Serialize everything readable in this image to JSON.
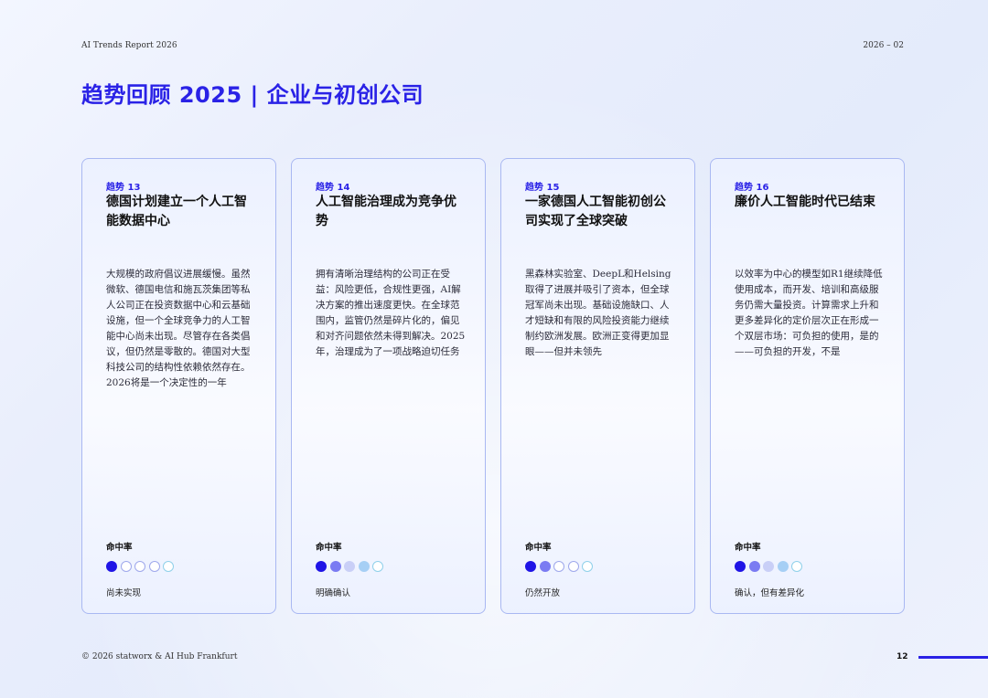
{
  "header": {
    "left": "AI Trends Report 2026",
    "right": "2026 – 02"
  },
  "title": "趋势回顾 2025 | 企业与初创公司",
  "rate_label": "命中率",
  "cards": [
    {
      "number": "趋势 13",
      "title": "德国计划建立一个人工智能数据中心",
      "body": "大规模的政府倡议进展缓慢。虽然微软、德国电信和施瓦茨集团等私人公司正在投资数据中心和云基础设施，但一个全球竞争力的人工智能中心尚未出现。尽管存在各类倡议，但仍然是零散的。德国对大型科技公司的结构性依赖依然存在。2026将是一个决定性的一年",
      "rating_filled": 1,
      "status": "尚未实现"
    },
    {
      "number": "趋势 14",
      "title": "人工智能治理成为竞争优势",
      "body": "拥有清晰治理结构的公司正在受益：风险更低，合规性更强，AI解决方案的推出速度更快。在全球范围内，监管仍然是碎片化的，偏见和对齐问题依然未得到解决。2025年，治理成为了一项战略迫切任务",
      "rating_filled": 4,
      "status": "明确确认"
    },
    {
      "number": "趋势 15",
      "title": "一家德国人工智能初创公司实现了全球突破",
      "body": "黑森林实验室、DeepL和Helsing取得了进展并吸引了资本，但全球冠军尚未出现。基础设施缺口、人才短缺和有限的风险投资能力继续制约欧洲发展。欧洲正变得更加显眼——但并未领先",
      "rating_filled": 2,
      "status": "仍然开放"
    },
    {
      "number": "趋势 16",
      "title": "廉价人工智能时代已结束",
      "body": "以效率为中心的模型如R1继续降低使用成本，而开发、培训和高级服务仍需大量投资。计算需求上升和更多差异化的定价层次正在形成一个双层市场：可负担的使用，是的——可负担的开发，不是",
      "rating_filled": 4,
      "status": "确认，但有差异化"
    }
  ],
  "colors": {
    "accent": "#2a22e6",
    "dot_filled": [
      "#1f14e6",
      "#7a7bf2",
      "#c9cff7",
      "#a6cff5"
    ],
    "dot_empty_border": [
      "#2a22e6",
      "#9ea8ec",
      "#9ea8ec",
      "#9ea8ec",
      "#8fd0ea"
    ]
  },
  "footer": {
    "left": "© 2026 statworx & AI Hub Frankfurt",
    "page": "12"
  }
}
